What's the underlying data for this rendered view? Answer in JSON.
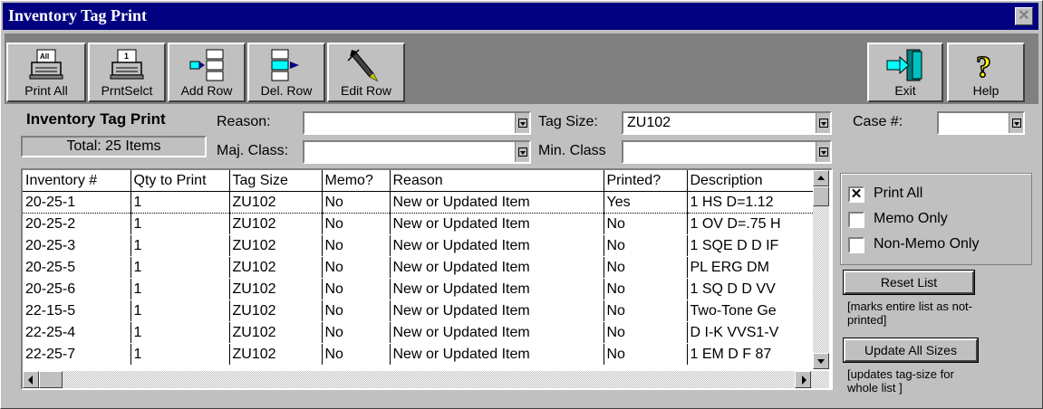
{
  "window": {
    "title": "Inventory Tag Print"
  },
  "toolbar": {
    "print_all": "Print All",
    "print_select": "PrntSelct",
    "add_row": "Add Row",
    "del_row": "Del. Row",
    "edit_row": "Edit Row",
    "exit": "Exit",
    "help": "Help"
  },
  "form": {
    "heading": "Inventory Tag Print",
    "total": "Total: 25 Items",
    "reason_label": "Reason:",
    "reason_value": "",
    "tag_size_label": "Tag Size:",
    "tag_size_value": "ZU102",
    "case_label": "Case #:",
    "case_value": "",
    "maj_class_label": "Maj. Class:",
    "maj_class_value": "",
    "min_class_label": "Min. Class",
    "min_class_value": ""
  },
  "grid": {
    "columns": [
      "Inventory #",
      "Qty to Print",
      "Tag Size",
      "Memo?",
      "Reason",
      "Printed?",
      "Description"
    ],
    "rows": [
      [
        "20-25-1",
        "1",
        "ZU102",
        "No",
        "New or Updated Item",
        "Yes",
        "1 HS D=1.12"
      ],
      [
        "20-25-2",
        "1",
        "ZU102",
        "No",
        "New or Updated Item",
        "No",
        "1 OV D=.75 H"
      ],
      [
        "20-25-3",
        "1",
        "ZU102",
        "No",
        "New or Updated Item",
        "No",
        "1 SQE D D IF"
      ],
      [
        "20-25-5",
        "1",
        "ZU102",
        "No",
        "New or Updated Item",
        "No",
        "PL ERG DM"
      ],
      [
        "20-25-6",
        "1",
        "ZU102",
        "No",
        "New or Updated Item",
        "No",
        "1 SQ D D VV"
      ],
      [
        "22-15-5",
        "1",
        "ZU102",
        "No",
        "New or Updated Item",
        "No",
        "Two-Tone Ge"
      ],
      [
        "22-25-4",
        "1",
        "ZU102",
        "No",
        "New or Updated Item",
        "No",
        "D I-K VVS1-V"
      ],
      [
        "22-25-7",
        "1",
        "ZU102",
        "No",
        "New or Updated Item",
        "No",
        "1 EM D F 87"
      ]
    ]
  },
  "options": {
    "print_all": "Print All",
    "memo_only": "Memo Only",
    "non_memo_only": "Non-Memo Only",
    "print_all_checked": true
  },
  "actions": {
    "reset_list": "Reset List",
    "reset_note": "[marks entire list as not-printed]",
    "update_sizes": "Update All Sizes",
    "update_note": "[updates tag-size for whole list ]"
  },
  "colors": {
    "titlebar": "#000080",
    "face": "#c0c0c0",
    "toolbar_bg": "#808080"
  },
  "icons": [
    "printer-icon",
    "printer-select-icon",
    "add-row-icon",
    "delete-row-icon",
    "edit-pen-icon",
    "exit-door-icon",
    "help-question-icon",
    "close-icon"
  ]
}
